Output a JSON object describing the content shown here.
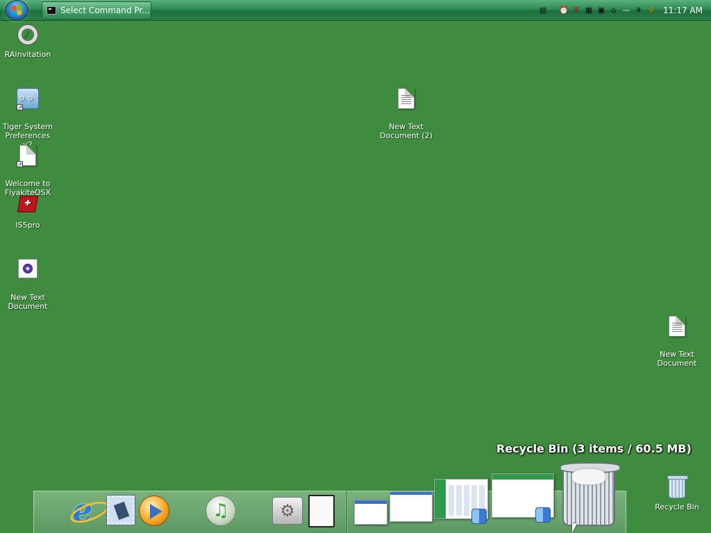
{
  "taskbar": {
    "start_button": "start-orb",
    "active_task": {
      "label": "Select Command Pr...",
      "icon": "command-prompt-icon"
    },
    "tray_icons": [
      "battery-icon",
      "alarm-clock-icon",
      "shield-icon",
      "network-icon",
      "monitor-icon",
      "presentation-icon",
      "line-icon",
      "satellite-icon",
      "search-icon"
    ],
    "clock": "11:17 AM"
  },
  "desktop": {
    "background_color": "#3f8b3f",
    "icons": [
      {
        "name": "RAInvitation",
        "icon": "lifebuoy-icon"
      },
      {
        "name": "Tiger System\nPreferences v2",
        "icon": "system-preferences-icon"
      },
      {
        "name": "Welcome to\nFlyakiteOSX",
        "icon": "document-icon"
      },
      {
        "name": "IS5pro",
        "icon": "package-icon"
      },
      {
        "name": "New Text\nDocument",
        "icon": "media-file-icon"
      },
      {
        "name": "New Text\nDocument (2)",
        "icon": "text-document-icon"
      },
      {
        "name": "New Text\nDocument",
        "icon": "text-document-icon"
      },
      {
        "name": "Recycle Bin",
        "icon": "recycle-bin-icon"
      }
    ]
  },
  "dock": {
    "tooltip": "Recycle Bin (3 items / 60.5 MB)",
    "items": [
      "internet-explorer-icon",
      "mail-icon",
      "media-player-icon",
      "itunes-icon",
      "system-preferences-icon",
      "document-icon",
      "window-thumbnail-1",
      "window-thumbnail-2",
      "window-thumbnail-3",
      "window-thumbnail-4",
      "trash-icon"
    ]
  }
}
